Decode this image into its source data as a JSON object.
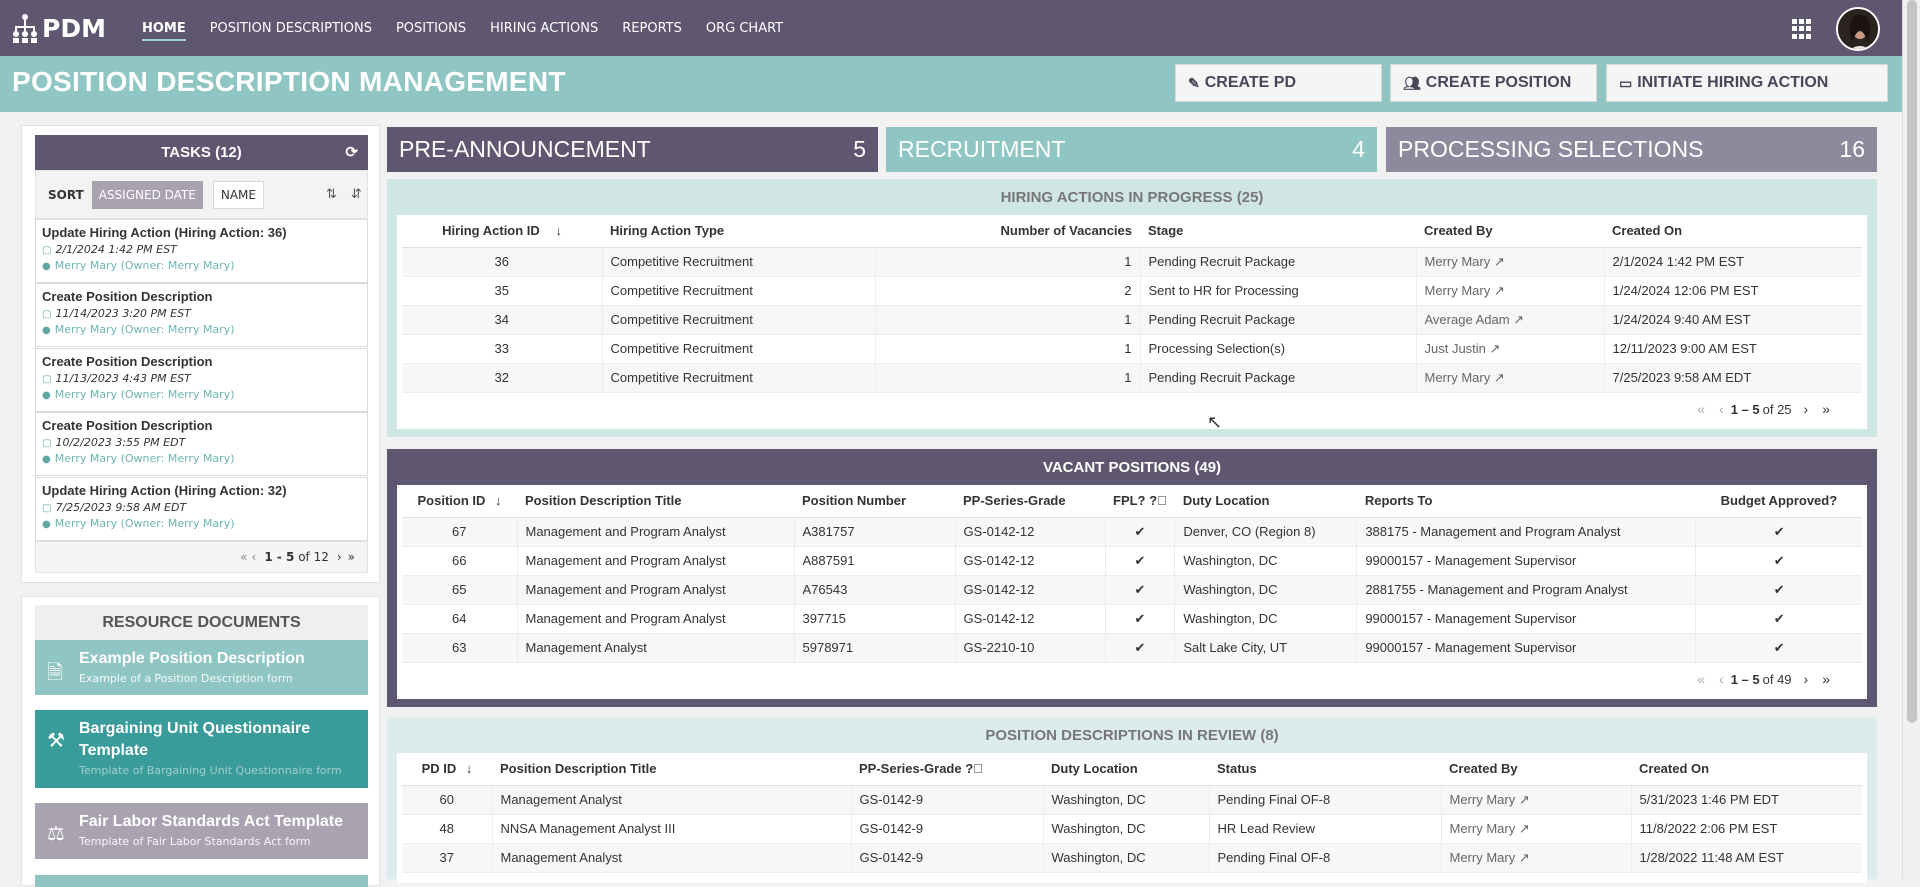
{
  "app": {
    "logo_text": "PDM"
  },
  "nav": [
    {
      "label": "HOME",
      "active": true
    },
    {
      "label": "POSITION DESCRIPTIONS"
    },
    {
      "label": "POSITIONS"
    },
    {
      "label": "HIRING ACTIONS"
    },
    {
      "label": "REPORTS"
    },
    {
      "label": "ORG CHART"
    }
  ],
  "header": {
    "title": "POSITION DESCRIPTION MANAGEMENT",
    "buttons": {
      "create_pd": "CREATE PD",
      "create_position": "CREATE POSITION",
      "initiate_hiring": "INITIATE HIRING ACTION"
    }
  },
  "tasks": {
    "title": "TASKS (12)",
    "sort_label": "SORT",
    "sort_assigned": "ASSIGNED DATE",
    "sort_name": "NAME",
    "items": [
      {
        "title": "Update Hiring Action (Hiring Action: 36)",
        "date": "2/1/2024 1:42 PM EST",
        "owner": "Merry Mary (Owner: Merry Mary)"
      },
      {
        "title": "Create Position Description",
        "date": "11/14/2023 3:20 PM EST",
        "owner": "Merry Mary (Owner: Merry Mary)"
      },
      {
        "title": "Create Position Description",
        "date": "11/13/2023 4:43 PM EST",
        "owner": "Merry Mary (Owner: Merry Mary)"
      },
      {
        "title": "Create Position Description",
        "date": "10/2/2023 3:55 PM EDT",
        "owner": "Merry Mary (Owner: Merry Mary)"
      },
      {
        "title": "Update Hiring Action (Hiring Action: 32)",
        "date": "7/25/2023 9:58 AM EDT",
        "owner": "Merry Mary (Owner: Merry Mary)"
      }
    ],
    "pager": {
      "range": "1 - 5",
      "of": "of 12"
    }
  },
  "resources": {
    "title": "RESOURCE DOCUMENTS",
    "items": [
      {
        "title": "Example Position Description",
        "subtitle": "Example of a Position Description form",
        "color": "#8fc6c3"
      },
      {
        "title": "Bargaining Unit Questionnaire Template",
        "subtitle": "Template of Bargaining Unit Questionnaire form",
        "color": "#3a9c9a"
      },
      {
        "title": "Fair Labor Standards Act Template",
        "subtitle": "Template of Fair Labor Standards Act form",
        "color": "#a9a3b1"
      }
    ]
  },
  "stats": [
    {
      "label": "PRE-ANNOUNCEMENT",
      "count": "5",
      "color": "#5f5670"
    },
    {
      "label": "RECRUITMENT",
      "count": "4",
      "color": "#8fc6c3"
    },
    {
      "label": "PROCESSING SELECTIONS",
      "count": "16",
      "color": "#8e8a9e"
    }
  ],
  "hiring": {
    "title": "HIRING ACTIONS IN PROGRESS (25)",
    "columns": [
      "Hiring Action ID",
      "Hiring Action Type",
      "Number of Vacancies",
      "Stage",
      "Created By",
      "Created On"
    ],
    "rows": [
      [
        "36",
        "Competitive Recruitment",
        "1",
        "Pending Recruit Package",
        "Merry Mary ↗",
        "2/1/2024 1:42 PM EST"
      ],
      [
        "35",
        "Competitive Recruitment",
        "2",
        "Sent to HR for Processing",
        "Merry Mary ↗",
        "1/24/2024 12:06 PM EST"
      ],
      [
        "34",
        "Competitive Recruitment",
        "1",
        "Pending Recruit Package",
        "Average Adam ↗",
        "1/24/2024 9:40 AM EST"
      ],
      [
        "33",
        "Competitive Recruitment",
        "1",
        "Processing Selection(s)",
        "Just Justin ↗",
        "12/11/2023 9:00 AM EST"
      ],
      [
        "32",
        "Competitive Recruitment",
        "1",
        "Pending Recruit Package",
        "Merry Mary ↗",
        "7/25/2023 9:58 AM EDT"
      ]
    ],
    "pager": {
      "range": "1 – 5",
      "of": "of 25"
    }
  },
  "vacant": {
    "title": "VACANT POSITIONS (49)",
    "columns": [
      "Position ID",
      "Position Description Title",
      "Position Number",
      "PP-Series-Grade",
      "FPL?",
      "Duty Location",
      "Reports To",
      "Budget Approved?"
    ],
    "rows": [
      [
        "67",
        "Management and Program Analyst",
        "A381757",
        "GS-0142-12",
        "✔",
        "Denver, CO (Region 8)",
        "388175 - Management and Program Analyst",
        "✔"
      ],
      [
        "66",
        "Management and Program Analyst",
        "A887591",
        "GS-0142-12",
        "✔",
        "Washington, DC",
        "99000157 - Management Supervisor",
        "✔"
      ],
      [
        "65",
        "Management and Program Analyst",
        "A76543",
        "GS-0142-12",
        "✔",
        "Washington, DC",
        "2881755 - Management and Program Analyst",
        "✔"
      ],
      [
        "64",
        "Management and Program Analyst",
        "397715",
        "GS-0142-12",
        "✔",
        "Washington, DC",
        "99000157 - Management Supervisor",
        "✔"
      ],
      [
        "63",
        "Management Analyst",
        "5978971",
        "GS-2210-10",
        "✔",
        "Salt Lake City, UT",
        "99000157 - Management Supervisor",
        "✔"
      ]
    ],
    "pager": {
      "range": "1 – 5",
      "of": "of 49"
    }
  },
  "pds": {
    "title": "POSITION DESCRIPTIONS IN REVIEW (8)",
    "columns": [
      "PD ID",
      "Position Description Title",
      "PP-Series-Grade",
      "Duty Location",
      "Status",
      "Created By",
      "Created On"
    ],
    "rows": [
      [
        "60",
        "Management Analyst",
        "GS-0142-9",
        "Washington, DC",
        "Pending Final OF-8",
        "Merry Mary ↗",
        "5/31/2023 1:46 PM EDT"
      ],
      [
        "48",
        "NNSA Management Analyst III",
        "GS-0142-9",
        "Washington, DC",
        "HR Lead Review",
        "Merry Mary ↗",
        "11/8/2022 2:06 PM EST"
      ],
      [
        "37",
        "Management Analyst",
        "GS-0142-9",
        "Washington, DC",
        "Pending Final OF-8",
        "Merry Mary ↗",
        "1/28/2022 11:48 AM EST"
      ]
    ]
  }
}
